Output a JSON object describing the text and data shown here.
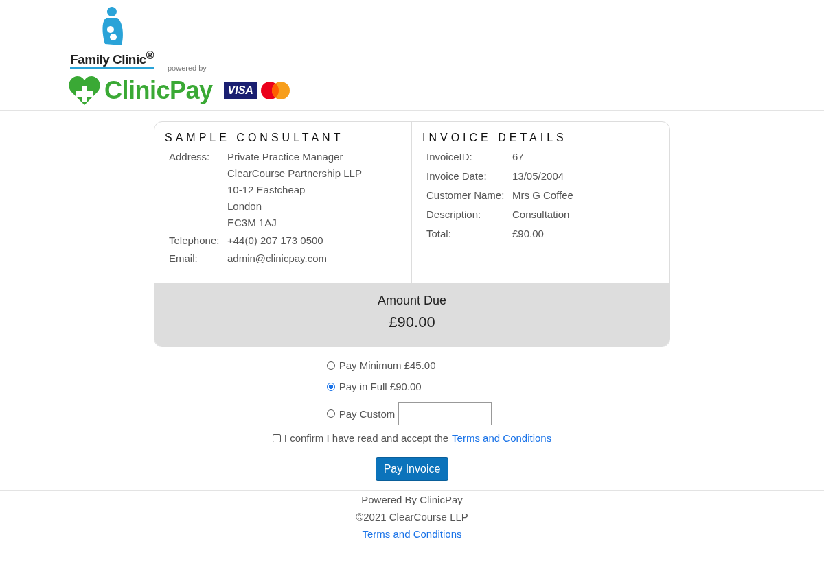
{
  "header": {
    "clinic_logo": "Family Clinic$^{®}$",
    "powered_by": "powered by",
    "pay_logo": "ClinicPay",
    "card_logo": "VISA"
  },
  "consultant": {
    "title": "SAMPLE CONSULTANT",
    "fields": [
      {
        "label": "Address:",
        "lines": [
          "Private Practice Manager",
          "ClearCourse Partnership LLP",
          "10-12 Eastcheap",
          "London",
          "EC3M 1AJ"
        ]
      },
      {
        "label": "Telephone:",
        "lines": [
          "+44(0) 207 173 0500"
        ]
      },
      {
        "label": "Email:",
        "lines": [
          "admin@clinicpay.com"
        ]
      }
    ]
  },
  "invoice": {
    "title": "INVOICE DETAILS",
    "fields": [
      {
        "label": "InvoiceID:",
        "value": "67"
      },
      {
        "label": "Invoice Date:",
        "value": "13/05/2004"
      },
      {
        "label": "Customer Name:",
        "value": "Mrs G Coffee"
      },
      {
        "label": "Description:",
        "value": "Consultation"
      },
      {
        "label": "Total:",
        "value": "£90.00"
      }
    ]
  },
  "amount_due": {
    "label": "Amount Due",
    "value": "£90.00"
  },
  "payment_options": [
    {
      "kind": "plain",
      "label": "Pay Minimum £45.00",
      "selected": false
    },
    {
      "kind": "plain",
      "label": "Pay in Full £90.00",
      "selected": true
    },
    {
      "kind": "custom",
      "label": "Pay Custom",
      "selected": false
    }
  ],
  "confirm": {
    "checked": false,
    "text": "I confirm I have read and accept the",
    "link": "Terms and Conditions"
  },
  "pay_button": "Pay Invoice",
  "footer": {
    "powered": "Powered By ClinicPay",
    "copyright": "©2021 ClearCourse LLP",
    "link": "Terms and Conditions"
  }
}
